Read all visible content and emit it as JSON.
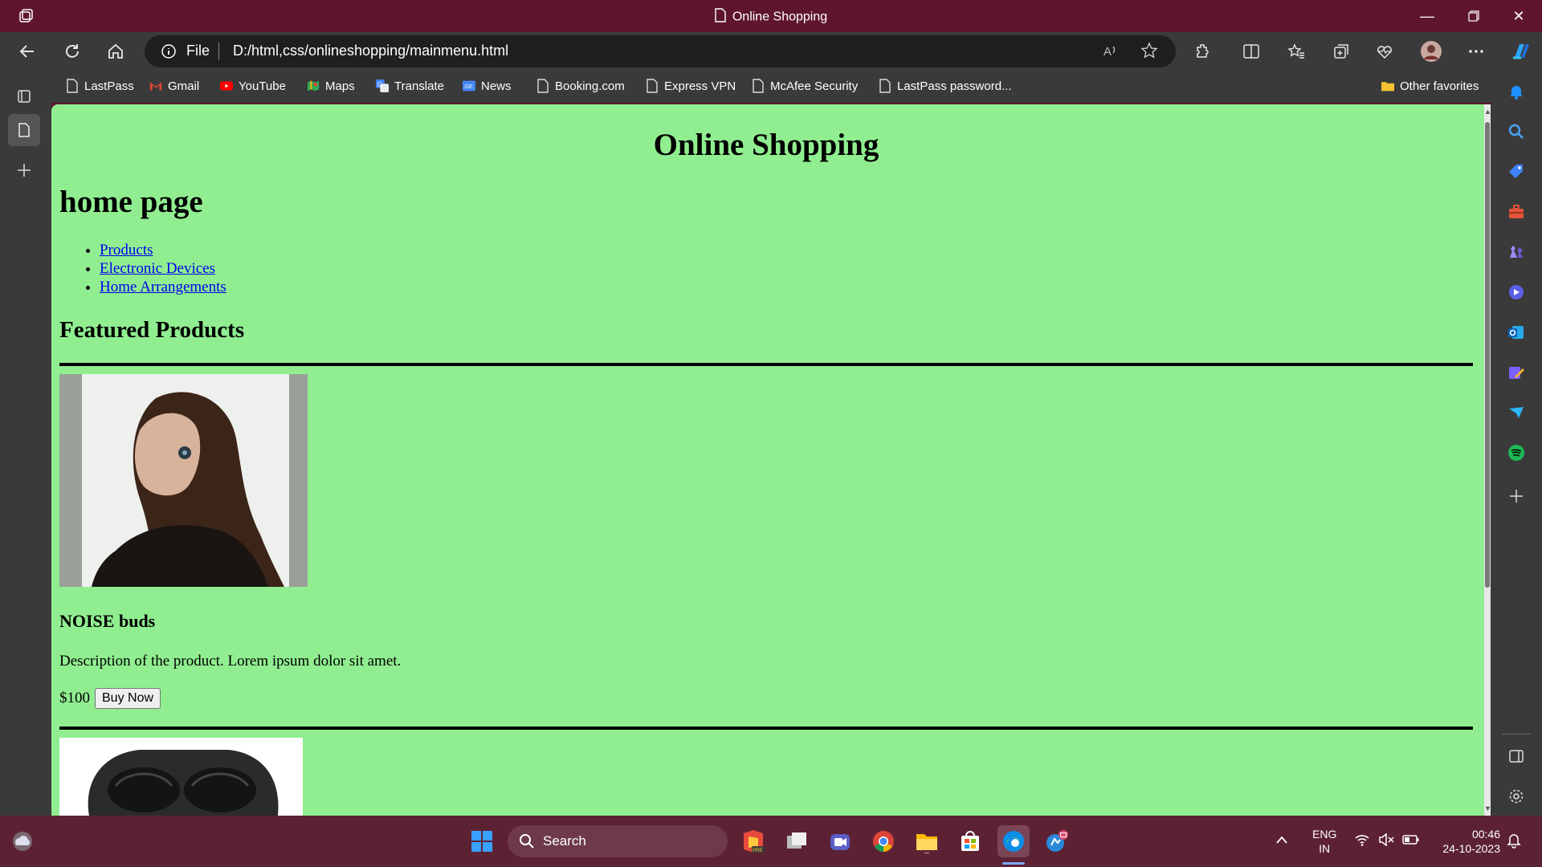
{
  "window": {
    "title": "Online Shopping"
  },
  "address_bar": {
    "scheme_label": "File",
    "url": "D:/html,css/onlineshopping/mainmenu.html"
  },
  "favorites": [
    {
      "label": "LastPass",
      "icon": "page-icon"
    },
    {
      "label": "Gmail",
      "icon": "gmail-icon"
    },
    {
      "label": "YouTube",
      "icon": "youtube-icon"
    },
    {
      "label": "Maps",
      "icon": "maps-icon"
    },
    {
      "label": "Translate",
      "icon": "translate-icon"
    },
    {
      "label": "News",
      "icon": "news-icon"
    },
    {
      "label": "Booking.com",
      "icon": "page-icon"
    },
    {
      "label": "Express VPN",
      "icon": "page-icon"
    },
    {
      "label": "McAfee Security",
      "icon": "page-icon"
    },
    {
      "label": "LastPass password...",
      "icon": "page-icon"
    }
  ],
  "other_favorites": "Other favorites",
  "page": {
    "title": "Online Shopping",
    "subtitle": "home page",
    "nav_links": [
      "Products",
      "Electronic Devices",
      "Home Arrangements"
    ],
    "section_title": "Featured Products",
    "product": {
      "name": "NOISE buds",
      "description": "Description of the product. Lorem ipsum dolor sit amet.",
      "price": "$100",
      "buy_label": "Buy Now"
    }
  },
  "taskbar": {
    "search_label": "Search",
    "lang_top": "ENG",
    "lang_bottom": "IN",
    "time": "00:46",
    "date": "24-10-2023"
  },
  "colors": {
    "titlebar": "#5f1530",
    "page_bg": "#90ee90",
    "link": "#0000ee",
    "taskbar": "#5c2234"
  }
}
